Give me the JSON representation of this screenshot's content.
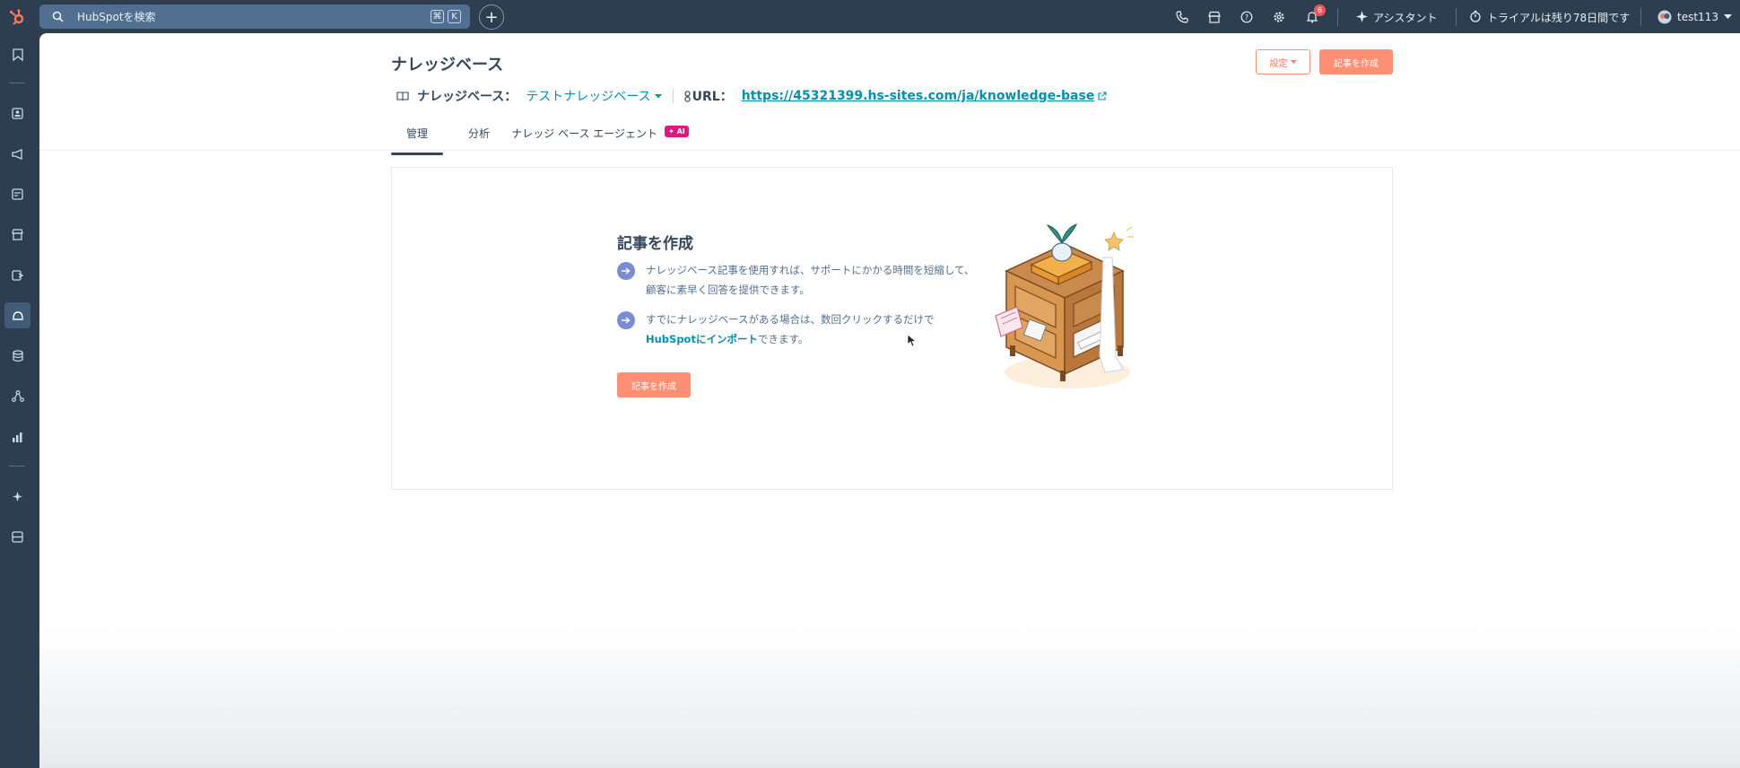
{
  "topbar": {
    "search_placeholder": "HubSpotを検索",
    "kbd1": "⌘",
    "kbd2": "K",
    "plus": "+",
    "notif_count": "6",
    "assistant": "アシスタント",
    "trial": "トライアルは残り78日間です",
    "user": "test113"
  },
  "header": {
    "title": "ナレッジベース",
    "settings_label": "設定",
    "create_label": "記事を作成",
    "kb_label": "ナレッジベース：",
    "kb_value": "テストナレッジベース",
    "url_label": "URL：",
    "url_value": "https://45321399.hs-sites.com/ja/knowledge-base"
  },
  "tabs": [
    {
      "label": "管理"
    },
    {
      "label": "分析"
    },
    {
      "label": "ナレッジ ベース エージェント"
    }
  ],
  "ai_badge": "AI",
  "empty_state": {
    "title": "記事を作成",
    "bullet1": "ナレッジベース記事を使用すれば、サポートにかかる時間を短縮して、顧客に素早く回答を提供できます。",
    "bullet2_pre": "すでにナレッジベースがある場合は、数回クリックするだけで",
    "bullet2_link": "HubSpotにインポート",
    "bullet2_post": "できます。",
    "button": "記事を作成"
  },
  "colors": {
    "nav_bg": "#2d3e50",
    "accent": "#ff8f73",
    "link": "#0091ae",
    "ai": "#e1177e"
  }
}
